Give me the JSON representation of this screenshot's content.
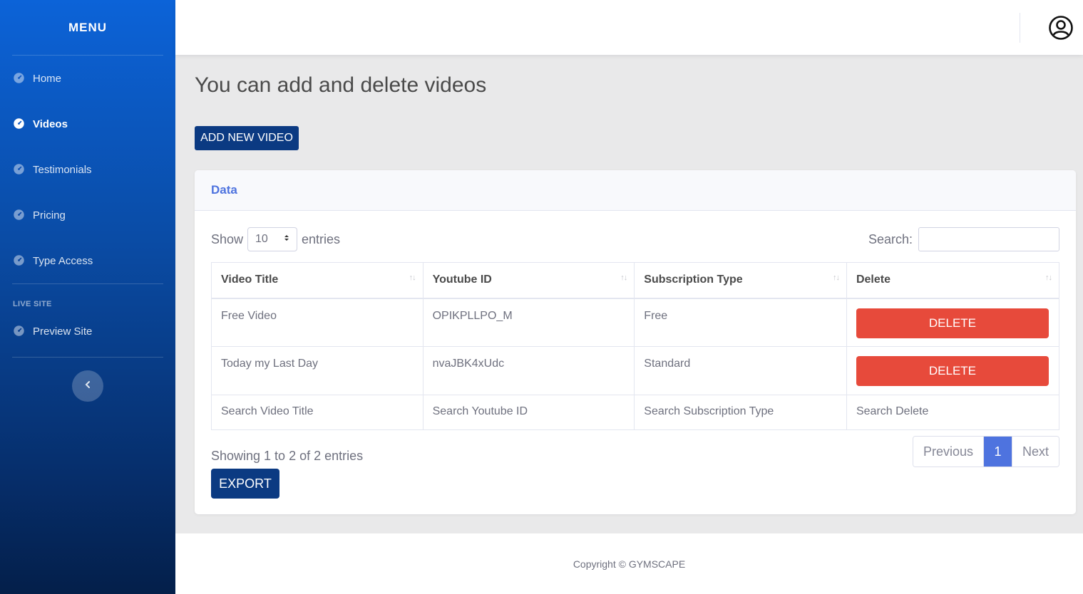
{
  "sidebar": {
    "brand": "MENU",
    "items": [
      {
        "label": "Home",
        "icon": "tachometer-icon"
      },
      {
        "label": "Videos",
        "icon": "tachometer-icon"
      },
      {
        "label": "Testimonials",
        "icon": "tachometer-icon"
      },
      {
        "label": "Pricing",
        "icon": "tachometer-icon"
      },
      {
        "label": "Type Access",
        "icon": "tachometer-icon"
      }
    ],
    "section_heading": "LIVE SITE",
    "live_items": [
      {
        "label": "Preview Site",
        "icon": "tachometer-icon"
      }
    ],
    "toggle_icon": "chevron-left-icon"
  },
  "topbar": {
    "user_icon": "user-circle-icon"
  },
  "page": {
    "title": "You can add and delete videos",
    "add_button": "ADD NEW VIDEO"
  },
  "card": {
    "header": "Data",
    "show_label": "Show",
    "entries_value": "10",
    "entries_label": "entries",
    "search_label": "Search:",
    "search_value": "",
    "columns": [
      "Video Title",
      "Youtube ID",
      "Subscription Type",
      "Delete"
    ],
    "rows": [
      {
        "title": "Free Video",
        "youtube_id": "OPIKPLLPO_M",
        "subscription": "Free",
        "action": "DELETE"
      },
      {
        "title": "Today my Last Day",
        "youtube_id": "nvaJBK4xUdc",
        "subscription": "Standard",
        "action": "DELETE"
      }
    ],
    "column_search_placeholders": [
      "Search Video Title",
      "Search Youtube ID",
      "Search Subscription Type",
      "Search Delete"
    ],
    "info": "Showing 1 to 2 of 2 entries",
    "export_button": "EXPORT",
    "pagination": {
      "previous": "Previous",
      "current": "1",
      "next": "Next"
    }
  },
  "footer": {
    "copyright": "Copyright © GYMSCAPE"
  },
  "colors": {
    "sidebar_top": "#0c63d8",
    "sidebar_bottom": "#041f4a",
    "primary_button": "#0b3a82",
    "delete_button": "#e74a3b",
    "accent": "#4e73df"
  }
}
